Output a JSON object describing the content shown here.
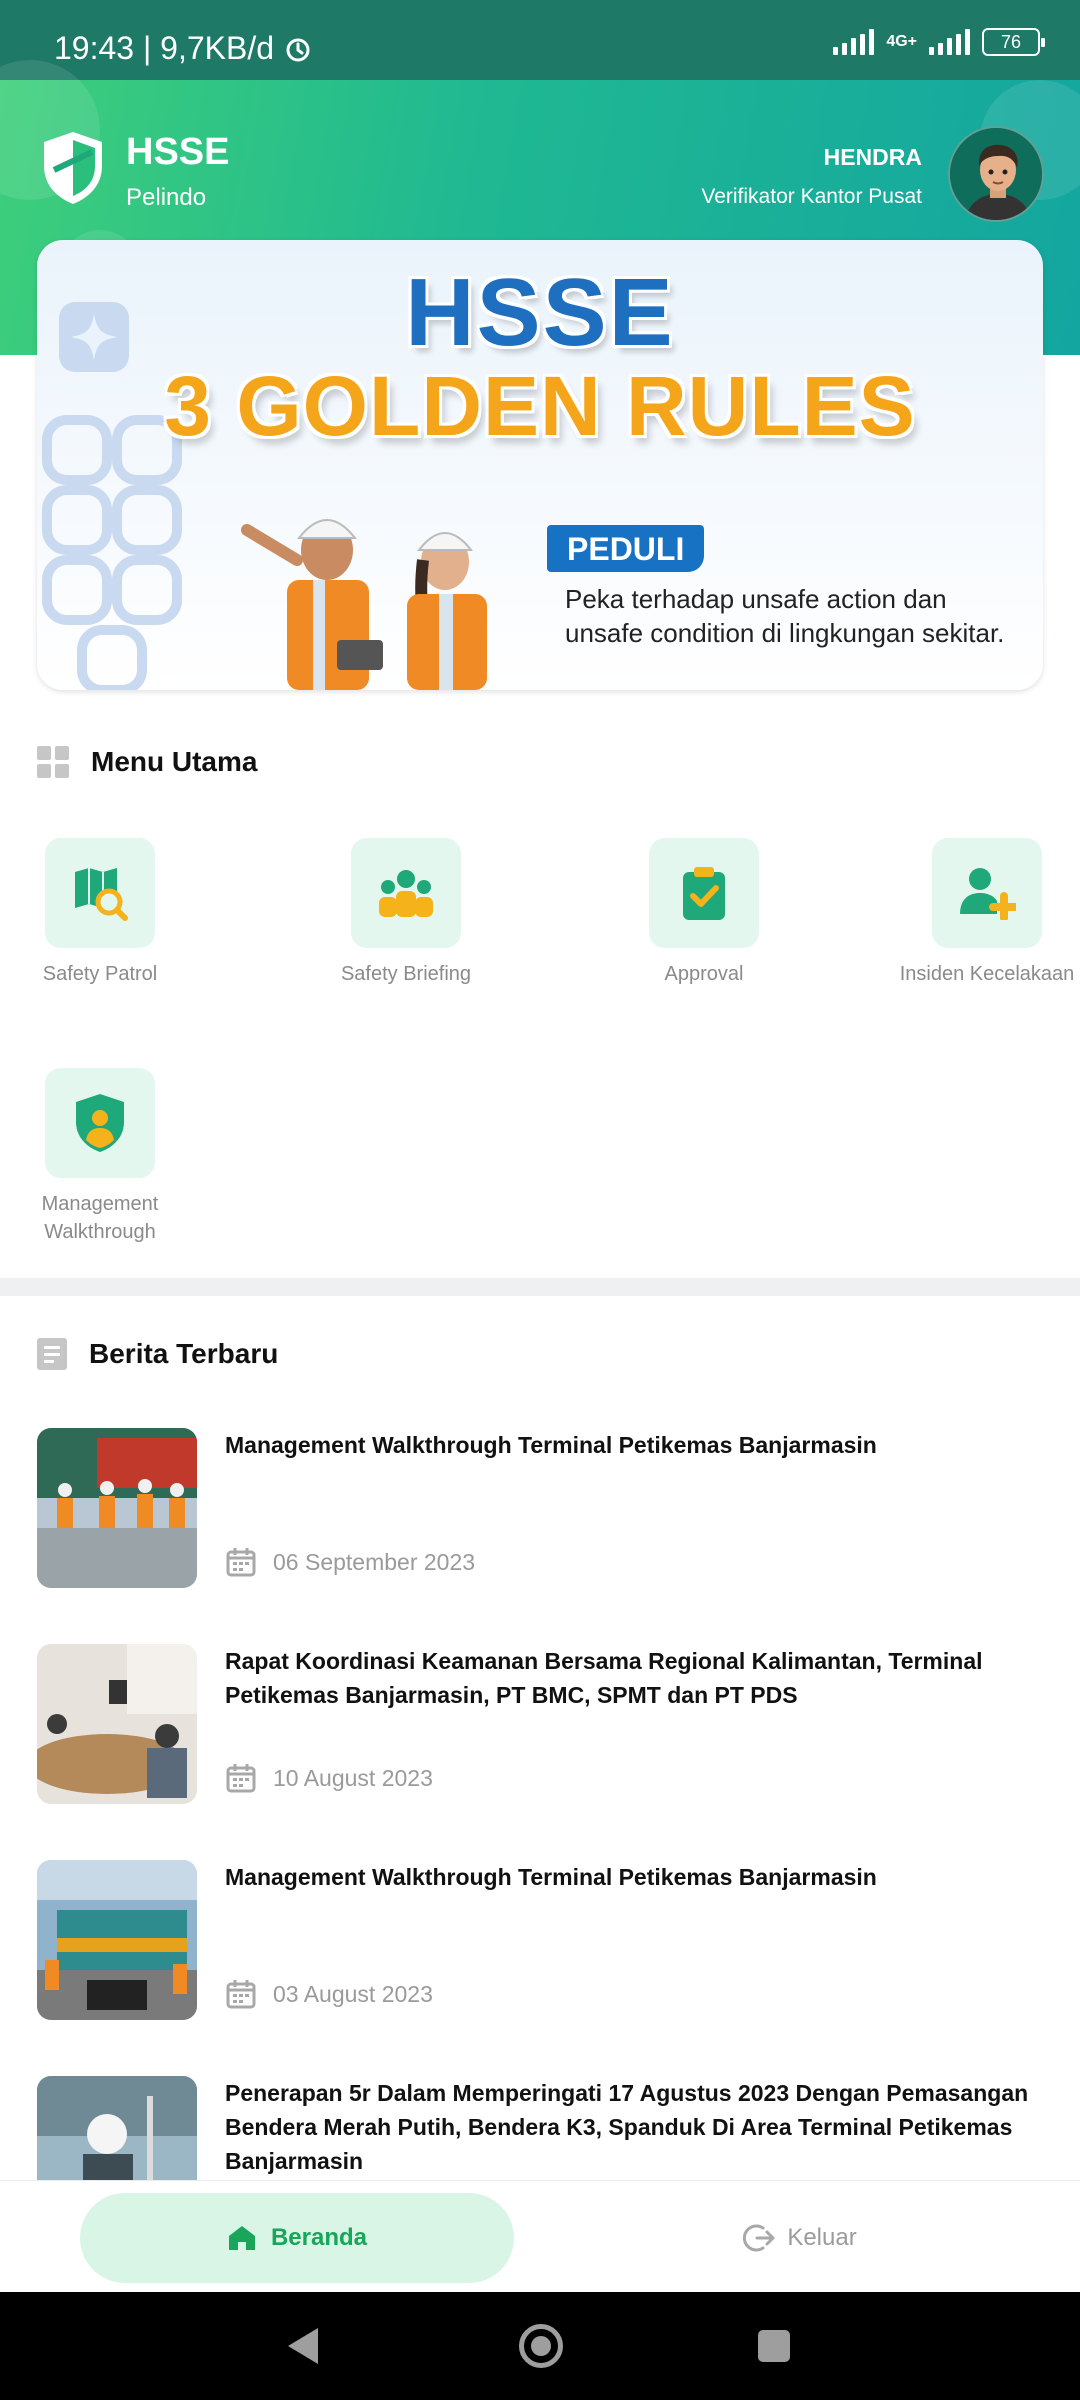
{
  "status_bar": {
    "time_speed": "19:43 | 9,7KB/d",
    "network": "4G+",
    "battery": "76"
  },
  "header": {
    "app_title": "HSSE",
    "app_subtitle": "Pelindo",
    "user_name": "HENDRA",
    "user_role": "Verifikator Kantor Pusat",
    "accent_color": "#1fb892"
  },
  "banner": {
    "title_line1": "HSSE",
    "title_line2": "3 GOLDEN RULES",
    "tag": "PEDULI",
    "text_line1": "Peka terhadap unsafe action dan",
    "text_line2": "unsafe condition di lingkungan sekitar."
  },
  "menu": {
    "title": "Menu Utama",
    "items": [
      {
        "label": "Safety Patrol",
        "icon": "map-search-icon"
      },
      {
        "label": "Safety Briefing",
        "icon": "group-icon"
      },
      {
        "label": "Approval",
        "icon": "clipboard-check-icon"
      },
      {
        "label": "Insiden Kecelakaan",
        "icon": "user-add-icon"
      },
      {
        "label": "Management Walkthrough",
        "icon": "shield-user-icon"
      }
    ]
  },
  "news": {
    "title": "Berita Terbaru",
    "items": [
      {
        "title": "Management Walkthrough Terminal Petikemas Banjarmasin",
        "date": "06 September 2023"
      },
      {
        "title": "Rapat Koordinasi Keamanan Bersama Regional Kalimantan, Terminal Petikemas Banjarmasin, PT BMC, SPMT dan PT PDS",
        "date": "10 August 2023"
      },
      {
        "title": "Management Walkthrough Terminal Petikemas Banjarmasin",
        "date": "03 August 2023"
      },
      {
        "title": "Penerapan 5r Dalam Memperingati 17 Agustus 2023 Dengan Pemasangan Bendera Merah Putih, Bendera K3, Spanduk Di Area Terminal Petikemas Banjarmasin",
        "date": ""
      }
    ]
  },
  "bottom_nav": {
    "home_label": "Beranda",
    "logout_label": "Keluar"
  }
}
